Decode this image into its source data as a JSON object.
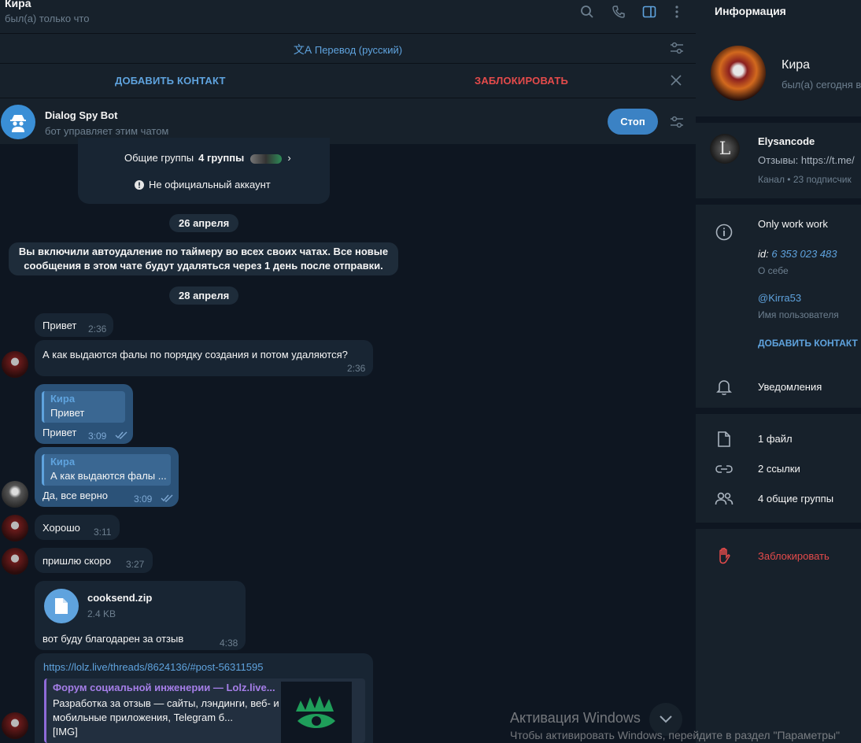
{
  "header": {
    "name": "Кира",
    "status": "был(а) только что"
  },
  "translate_bar": {
    "label": "Перевод (русский)"
  },
  "contact_bar": {
    "add_label": "ДОБАВИТЬ КОНТАКТ",
    "block_label": "ЗАБЛОКИРОВАТЬ"
  },
  "bot_bar": {
    "name": "Dialog Spy Bot",
    "subtitle": "бот управляет этим чатом",
    "stop_label": "Стоп"
  },
  "info_card": {
    "groups_label": "Общие группы",
    "groups_value": "4 группы",
    "not_official": "Не официальный аккаунт"
  },
  "dates": {
    "first": "26 апреля",
    "second": "28 апреля"
  },
  "service_message": "Вы включили автоудаление по таймеру во всех своих чатах. Все новые сообщения в этом чате будут удаляться через 1 день после отправки.",
  "messages": [
    {
      "text": "Привет",
      "time": "2:36"
    },
    {
      "text": "А как выдаются фалы по порядку создания и потом удаляются?",
      "time": "2:36"
    },
    {
      "quote_name": "Кира",
      "quote_text": "Привет",
      "text": "Привет",
      "time": "3:09"
    },
    {
      "quote_name": "Кира",
      "quote_text": "А как выдаются фалы ...",
      "text": "Да, все верно",
      "time": "3:09"
    },
    {
      "text": "Хорошо",
      "time": "3:11"
    },
    {
      "text": "пришлю скоро",
      "time": "3:27"
    },
    {
      "file_name": "cooksend.zip",
      "file_size": "2.4 KB",
      "text": "вот буду благодарен за отзыв",
      "time": "4:38"
    }
  ],
  "link_message": {
    "url": "https://lolz.live/threads/8624136/#post-56311595",
    "site": "Форум социальной инженерии — Lolz.live...",
    "title": "Разработка за отзыв — сайты, лэндинги, веб- и мобильные приложения, Telegram б...",
    "img": "[IMG]"
  },
  "watermark": {
    "title": "Активация Windows",
    "subtitle": "Чтобы активировать Windows, перейдите в раздел \"Параметры\""
  },
  "panel": {
    "title": "Информация",
    "name": "Кира",
    "status": "был(а) сегодня в",
    "channel": {
      "name": "Elysancode",
      "desc": "Отзывы: https://t.me/",
      "sub": "Канал • 23 подписчик"
    },
    "about": {
      "text": "Only work work",
      "id_label": "id:",
      "id_value": "6 353 023 483",
      "id_caption": "О себе"
    },
    "username": {
      "value": "@Kirra53",
      "caption": "Имя пользователя"
    },
    "add_contact": "ДОБАВИТЬ КОНТАКТ",
    "notifications": "Уведомления",
    "files": "1 файл",
    "links": "2 ссылки",
    "groups": "4 общие группы",
    "block": "Заблокировать"
  },
  "colors": {
    "accent": "#5fa3de",
    "danger": "#e54b4b",
    "bg": "#0e1621",
    "panel": "#17212b",
    "bubble_in": "#182533",
    "bubble_out": "#2b5278"
  }
}
